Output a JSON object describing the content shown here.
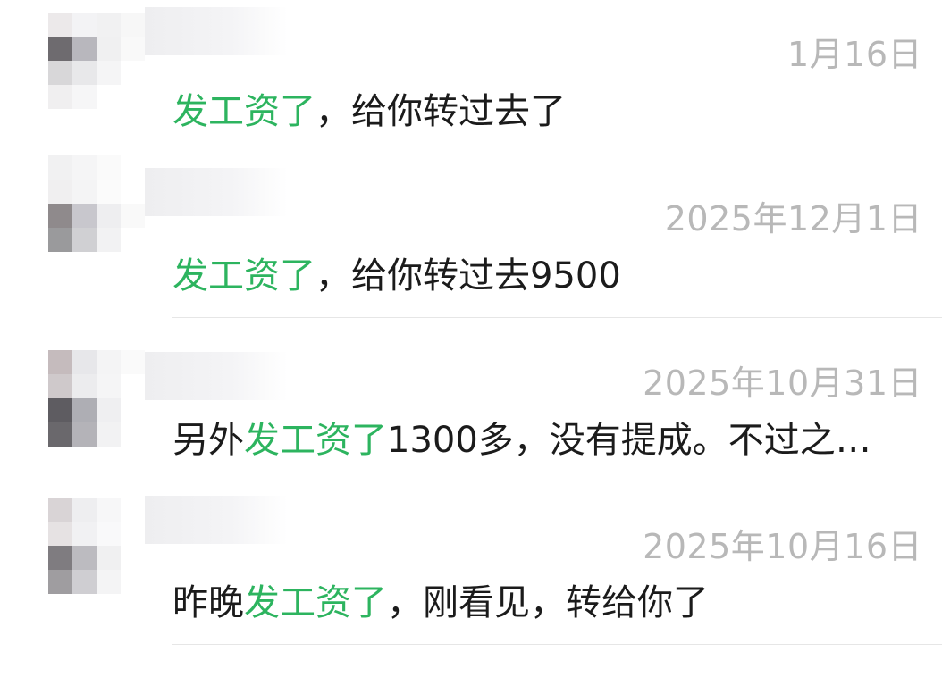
{
  "keyword": "发工资了",
  "accent_color": "#2db45f",
  "results": [
    {
      "date": "1月16日",
      "prefix": "",
      "highlight": "发工资了",
      "suffix": "，给你转过去了"
    },
    {
      "date": "2025年12月1日",
      "prefix": "",
      "highlight": "发工资了",
      "suffix": "，给你转过去9500"
    },
    {
      "date": "2025年10月31日",
      "prefix": "另外",
      "highlight": "发工资了",
      "suffix": "1300多，没有提成。不过之…"
    },
    {
      "date": "2025年10月16日",
      "prefix": "昨晚",
      "highlight": "发工资了",
      "suffix": "，刚看见，转给你了"
    }
  ]
}
